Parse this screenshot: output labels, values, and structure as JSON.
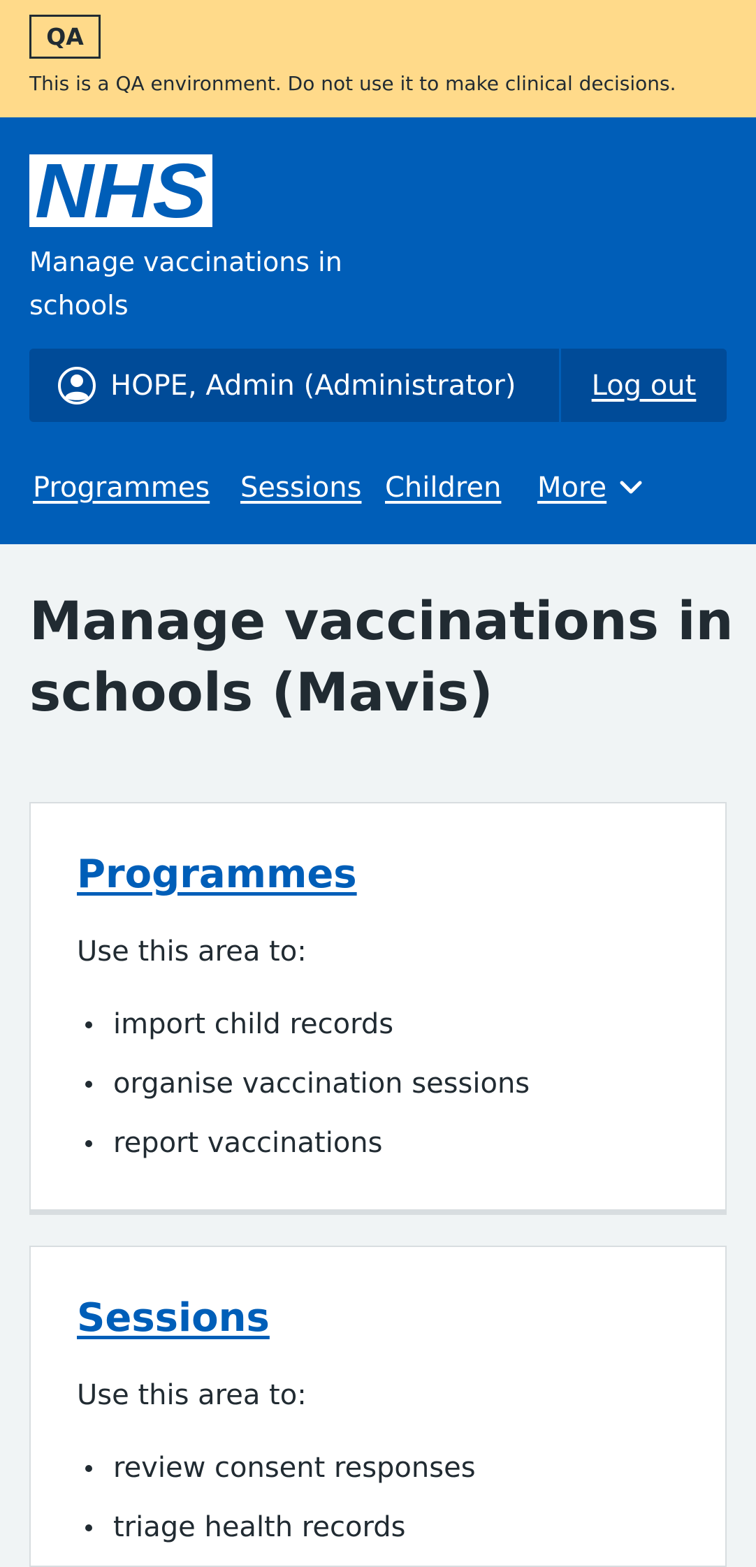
{
  "qa_banner": {
    "tag": "QA",
    "text": "This is a QA environment. Do not use it to make clinical decisions."
  },
  "header": {
    "logo_text": "NHS",
    "service_name": "Manage vaccinations in schools",
    "account": {
      "user_label": "HOPE, Admin (Administrator)",
      "logout_label": "Log out"
    },
    "nav": {
      "items": [
        {
          "label": "Programmes"
        },
        {
          "label": "Sessions"
        },
        {
          "label": "Children"
        },
        {
          "label": "More"
        }
      ]
    }
  },
  "main": {
    "title": "Manage vaccinations in schools (Mavis)",
    "cards": [
      {
        "title": "Programmes",
        "intro": "Use this area to:",
        "items": [
          "import child records",
          "organise vaccination sessions",
          "report vaccinations"
        ]
      },
      {
        "title": "Sessions",
        "intro": "Use this area to:",
        "items": [
          "review consent responses",
          "triage health records"
        ]
      }
    ]
  },
  "colors": {
    "qa_banner": "#ffda8a",
    "header": "#005eb8",
    "account_bar": "#004b98",
    "page_background": "#f0f4f5",
    "link": "#005eb8",
    "text": "#212b32"
  },
  "icons": {
    "user": "user-circle-icon",
    "more": "chevron-down-icon"
  }
}
